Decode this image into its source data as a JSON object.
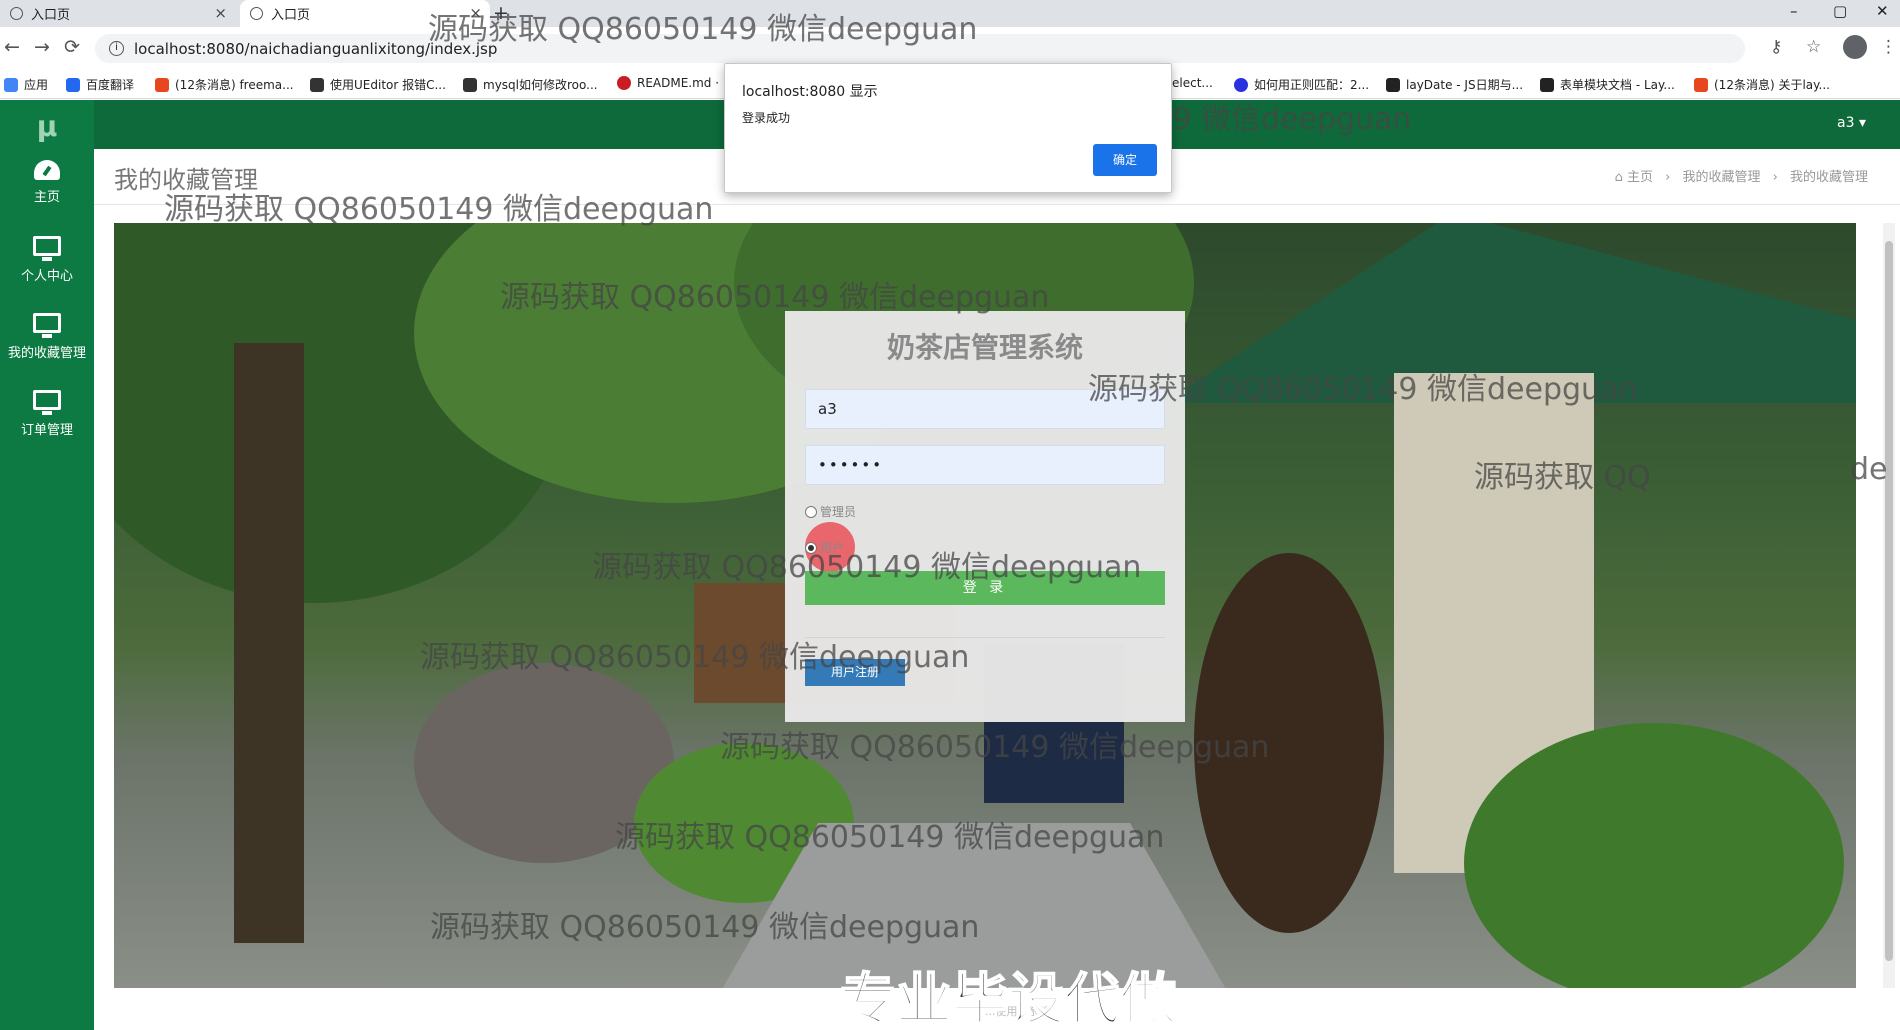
{
  "browser": {
    "tabs": [
      {
        "title": "入口页",
        "close": "×"
      },
      {
        "title": "入口页",
        "close": "×"
      }
    ],
    "new_tab": "+",
    "window_controls": [
      "–",
      "▢",
      "✕"
    ],
    "url": "localhost:8080/naichadianguanlixitong/index.jsp",
    "url_info_icon": "i",
    "nav": {
      "back": "←",
      "forward": "→",
      "reload": "⟳"
    },
    "addr_icons": {
      "key": "⚷",
      "star": "☆",
      "menu": "⋮"
    },
    "bookmarks": [
      {
        "label": "应用",
        "icon": "apps-icon",
        "color": "#4285f4"
      },
      {
        "label": "百度翻译",
        "icon": "baidu-translate-icon",
        "color": "#2468f2"
      },
      {
        "label": "(12条消息) freema...",
        "icon": "csdn-icon",
        "color": "#e8461f"
      },
      {
        "label": "使用UEditor 报错C...",
        "icon": "link-icon",
        "color": "#333333"
      },
      {
        "label": "mysql如何修改roo...",
        "icon": "link-icon",
        "color": "#333333"
      },
      {
        "label": "README.md ·",
        "icon": "gitee-icon",
        "color": "#c71d23"
      },
      {
        "label": "elect...",
        "icon": "page-icon",
        "color": "#999999"
      },
      {
        "label": "如何用正则匹配：2...",
        "icon": "baidu-icon",
        "color": "#2932e1"
      },
      {
        "label": "layDate - JS日期与...",
        "icon": "layui-icon",
        "color": "#222222"
      },
      {
        "label": "表单模块文档 - Lay...",
        "icon": "layui-icon",
        "color": "#222222"
      },
      {
        "label": "(12条消息) 关于lay...",
        "icon": "csdn-icon",
        "color": "#e8461f"
      }
    ]
  },
  "sidebar": {
    "logo": "μ",
    "items": [
      {
        "label": "主页",
        "icon": "dashboard-icon"
      },
      {
        "label": "个人中心",
        "icon": "monitor-icon"
      },
      {
        "label": "我的收藏管理",
        "icon": "monitor-icon"
      },
      {
        "label": "订单管理",
        "icon": "monitor-icon"
      }
    ]
  },
  "header": {
    "user": "a3 ▾"
  },
  "page": {
    "title": "我的收藏管理",
    "breadcrumb": [
      "⌂ 主页",
      "›",
      "我的收藏管理",
      "›",
      "我的收藏管理"
    ]
  },
  "login": {
    "title": "奶茶店管理系统",
    "username": "a3",
    "password": "••••••",
    "roles": [
      "管理员",
      "用户"
    ],
    "selected_role": "用户",
    "login_button": "登 录",
    "register_button": "用户注册"
  },
  "alert": {
    "title": "localhost:8080 显示",
    "message": "登录成功",
    "ok": "确定"
  },
  "watermark": "源码获取 QQ86050149 微信deepguan",
  "watermark_partial": "源码获取 QQ",
  "watermark_tail": "de",
  "footer": "...使用...系统",
  "promo": "专业毕设代做",
  "colors": {
    "sidebar": "#0e7a43",
    "header": "#0e6a3b",
    "login_button": "#5cb85c",
    "register_button": "#337ab7",
    "alert_ok": "#1a73e8"
  }
}
